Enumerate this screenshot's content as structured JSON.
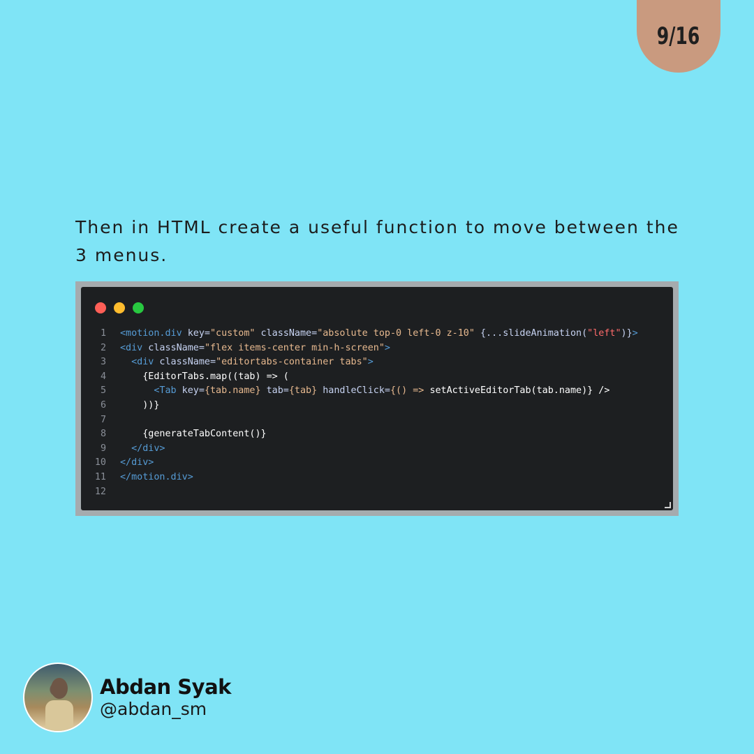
{
  "page_indicator": "9/16",
  "intro_text": "Then in HTML create a useful function to move between the 3 menus.",
  "code_window": {
    "window_buttons": [
      "close",
      "minimize",
      "zoom"
    ],
    "colors": {
      "background": "#1d1f21",
      "tag": "#569cd6",
      "attribute": "#c7d3f2",
      "string": "#e7b98f",
      "accent_red": "#ff6b6b"
    },
    "line_numbers": [
      "1",
      "2",
      "3",
      "4",
      "5",
      "6",
      "7",
      "8",
      "9",
      "10",
      "11",
      "12"
    ],
    "lines": [
      [
        {
          "t": "<motion.div",
          "c": "tg"
        },
        {
          "t": " key=",
          "c": "at"
        },
        {
          "t": "\"custom\"",
          "c": "st"
        },
        {
          "t": " className=",
          "c": "at"
        },
        {
          "t": "\"absolute top-0 left-0 z-10\"",
          "c": "st"
        },
        {
          "t": " {...slideAnimation(",
          "c": "at"
        },
        {
          "t": "\"left\"",
          "c": "rd"
        },
        {
          "t": ")}",
          "c": "at"
        },
        {
          "t": ">",
          "c": "tg"
        }
      ],
      [
        {
          "t": "<div",
          "c": "tg"
        },
        {
          "t": " className=",
          "c": "at"
        },
        {
          "t": "\"flex items-center min-h-screen\"",
          "c": "st"
        },
        {
          "t": ">",
          "c": "tg"
        }
      ],
      [
        {
          "t": "  <div",
          "c": "tg"
        },
        {
          "t": " className=",
          "c": "at"
        },
        {
          "t": "\"editortabs-container tabs\"",
          "c": "st"
        },
        {
          "t": ">",
          "c": "tg"
        }
      ],
      [
        {
          "t": "    {EditorTabs.map((tab) => (",
          "c": "fn"
        }
      ],
      [
        {
          "t": "      <Tab",
          "c": "tg"
        },
        {
          "t": " key=",
          "c": "at"
        },
        {
          "t": "{tab.name}",
          "c": "st"
        },
        {
          "t": " tab=",
          "c": "at"
        },
        {
          "t": "{tab}",
          "c": "st"
        },
        {
          "t": " handleClick=",
          "c": "at"
        },
        {
          "t": "{() => ",
          "c": "st"
        },
        {
          "t": "setActiveEditorTab(tab.name)} />",
          "c": "fn"
        }
      ],
      [
        {
          "t": "    ))}",
          "c": "fn"
        }
      ],
      [
        {
          "t": "",
          "c": "fn"
        }
      ],
      [
        {
          "t": "    {generateTabContent()}",
          "c": "fn"
        }
      ],
      [
        {
          "t": "  </div>",
          "c": "tg"
        }
      ],
      [
        {
          "t": "</div>",
          "c": "tg"
        }
      ],
      [
        {
          "t": "</motion.div>",
          "c": "tg"
        }
      ],
      [
        {
          "t": "",
          "c": "fn"
        }
      ]
    ]
  },
  "author": {
    "name": "Abdan Syak",
    "handle": "@abdan_sm"
  },
  "colors": {
    "page_background": "#7fe4f6",
    "badge_background": "#c99a7f",
    "frame": "#a5abae"
  }
}
